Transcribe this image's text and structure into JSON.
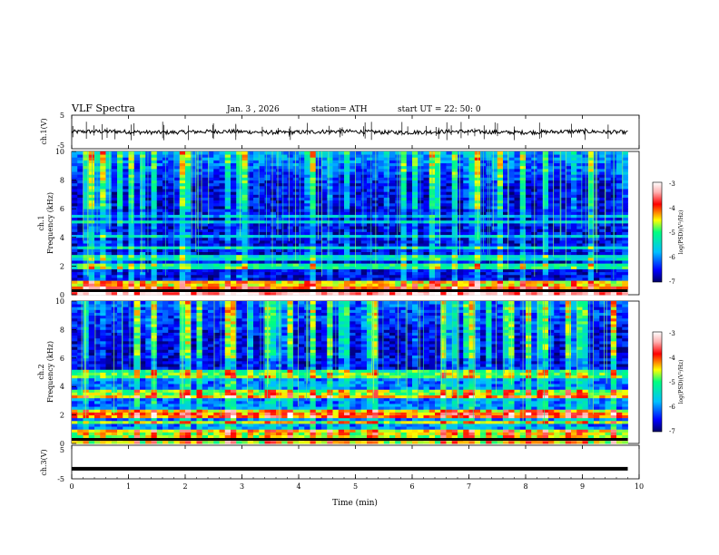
{
  "header": {
    "title": "VLF  Spectra",
    "date": "Jan.  3  , 2026",
    "station": "station= ATH",
    "start": "start  UT  =   22: 50: 0"
  },
  "colors": {
    "background": "#ffffff",
    "axis": "#000000",
    "colormap": [
      "#000066",
      "#0000ff",
      "#00c0ff",
      "#00ff80",
      "#ffff00",
      "#ff0000",
      "#ffc0c0",
      "#ffffff"
    ]
  },
  "chart_data": [
    {
      "type": "line",
      "panel": "ch1-waveform",
      "ylabel": "ch.1(V)",
      "ylim": [
        -5,
        5
      ],
      "yticks": [
        "5",
        "-5"
      ],
      "x_range_min": [
        0,
        10
      ],
      "grid": false,
      "description_of_series": "waveform near 0 V, amplitude about ±0.7 V",
      "series": [
        {
          "x": [
            0,
            1,
            2,
            3,
            4,
            5,
            6,
            7,
            8,
            9,
            9.8
          ],
          "values": [
            0.1,
            -0.1,
            0.2,
            0.0,
            0.1,
            -0.2,
            0.0,
            0.3,
            0.2,
            0.4,
            0.1
          ]
        }
      ]
    },
    {
      "type": "heatmap",
      "panel": "ch1-spectrogram",
      "ylabel": "Frequency (kHz)",
      "channel_label": "ch.1",
      "ylim": [
        0,
        10
      ],
      "yticks": [
        "0",
        "2",
        "4",
        "6",
        "8",
        "10"
      ],
      "x_range_min": [
        0,
        9.8
      ],
      "colorbar": {
        "label": "log(PSD)(V²/Hz)",
        "range": [
          -7,
          -3
        ],
        "ticks": [
          "-3",
          "-4",
          "-5",
          "-6",
          "-7"
        ]
      },
      "horizontal_bands_kHz": [
        {
          "f": 0.2,
          "level": -3.5
        },
        {
          "f": 0.5,
          "level": -4.0
        },
        {
          "f": 0.8,
          "level": -4.5
        },
        {
          "f": 2.0,
          "level": -5.2
        },
        {
          "f": 2.6,
          "level": -5.5
        },
        {
          "f": 3.3,
          "level": -5.6
        },
        {
          "f": 4.1,
          "level": -5.8
        },
        {
          "f": 5.1,
          "level": -5.7
        },
        {
          "f": 5.5,
          "level": -5.9
        }
      ]
    },
    {
      "type": "heatmap",
      "panel": "ch2-spectrogram",
      "ylabel": "Frequency (kHz)",
      "channel_label": "ch.2",
      "ylim": [
        0,
        10
      ],
      "yticks": [
        "0",
        "2",
        "4",
        "6",
        "8",
        "10"
      ],
      "x_range_min": [
        0,
        9.8
      ],
      "colorbar": {
        "label": "log(PSD)(V²/Hz)",
        "range": [
          -7,
          -3
        ],
        "ticks": [
          "-3",
          "-4",
          "-5",
          "-6",
          "-7"
        ]
      },
      "horizontal_bands_kHz": [
        {
          "f": 0.3,
          "level": -3.8
        },
        {
          "f": 0.9,
          "level": -4.5
        },
        {
          "f": 1.5,
          "level": -4.8
        },
        {
          "f": 2.0,
          "level": -4.2
        },
        {
          "f": 2.3,
          "level": -4.5
        },
        {
          "f": 3.3,
          "level": -4.4
        },
        {
          "f": 3.6,
          "level": -4.8
        },
        {
          "f": 4.8,
          "level": -5.0
        },
        {
          "f": 5.1,
          "level": -5.2
        }
      ]
    },
    {
      "type": "line",
      "panel": "ch3-waveform",
      "ylabel": "ch.3(V)",
      "ylim": [
        -5,
        5
      ],
      "yticks": [
        "5",
        "-5"
      ],
      "x_range_min": [
        0,
        10
      ],
      "series": [
        {
          "x": [
            0,
            9.8
          ],
          "values": [
            -2,
            -2
          ]
        }
      ],
      "xlabel": "Time  (min)",
      "xticks": [
        "0",
        "1",
        "2",
        "3",
        "4",
        "5",
        "6",
        "7",
        "8",
        "9",
        "10"
      ]
    }
  ]
}
